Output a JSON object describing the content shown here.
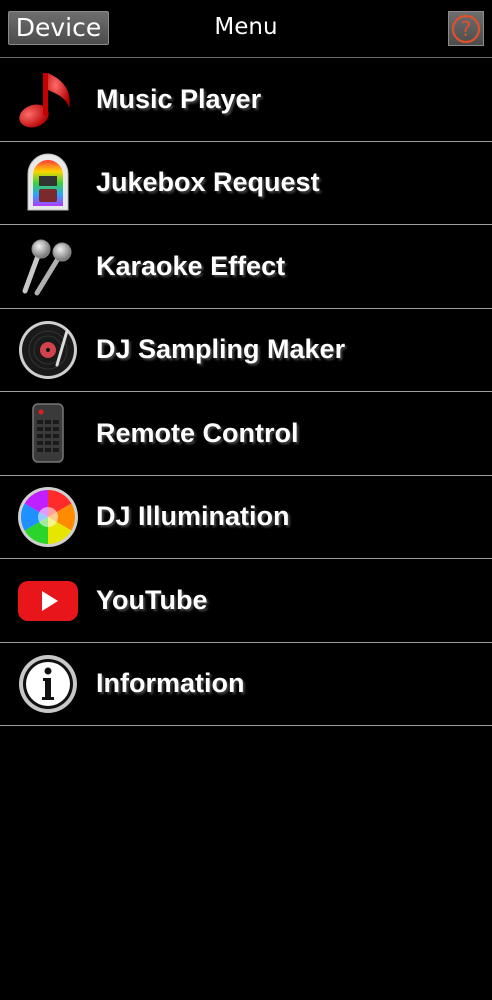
{
  "header": {
    "device_label": "Device",
    "title": "Menu",
    "help_glyph": "?"
  },
  "menu": {
    "items": [
      {
        "label": "Music Player",
        "icon": "music-note-icon"
      },
      {
        "label": "Jukebox Request",
        "icon": "jukebox-icon"
      },
      {
        "label": "Karaoke Effect",
        "icon": "microphones-icon"
      },
      {
        "label": "DJ Sampling Maker",
        "icon": "turntable-icon"
      },
      {
        "label": "Remote Control",
        "icon": "remote-control-icon"
      },
      {
        "label": "DJ Illumination",
        "icon": "color-wheel-icon"
      },
      {
        "label": "YouTube",
        "icon": "youtube-icon"
      },
      {
        "label": "Information",
        "icon": "info-icon"
      }
    ]
  },
  "colors": {
    "background": "#000000",
    "divider": "#9aa09a",
    "help_accent": "#e0502a",
    "youtube_red": "#e8161b"
  }
}
